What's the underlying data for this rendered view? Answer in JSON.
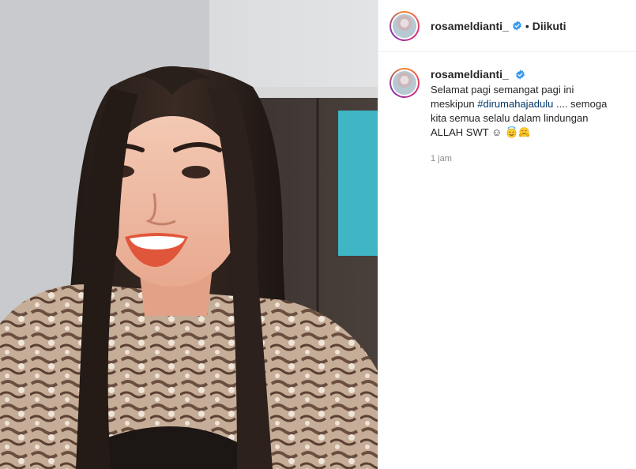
{
  "post": {
    "username": "rosameldianti_",
    "separator": "•",
    "follow_status": "Diikuti",
    "caption": {
      "text_before": "Selamat pagi semangat pagi ini meskipun ",
      "hashtag": "#dirumahajadulu",
      "text_after": " .... semoga kita semua selalu dalam lindungan ALLAH SWT ☺",
      "emojis": [
        "smiling-face-with-halo",
        "hugging-face"
      ]
    },
    "timestamp": "1 jam"
  },
  "icons": {
    "verified": "verified-badge-icon",
    "avatar": "profile-avatar"
  },
  "colors": {
    "verified_blue": "#3897f0",
    "hashtag": "#00376b",
    "muted": "#8e8e8e",
    "text": "#262626",
    "ring_start": "#f58529",
    "ring_mid": "#dd2a7b"
  }
}
